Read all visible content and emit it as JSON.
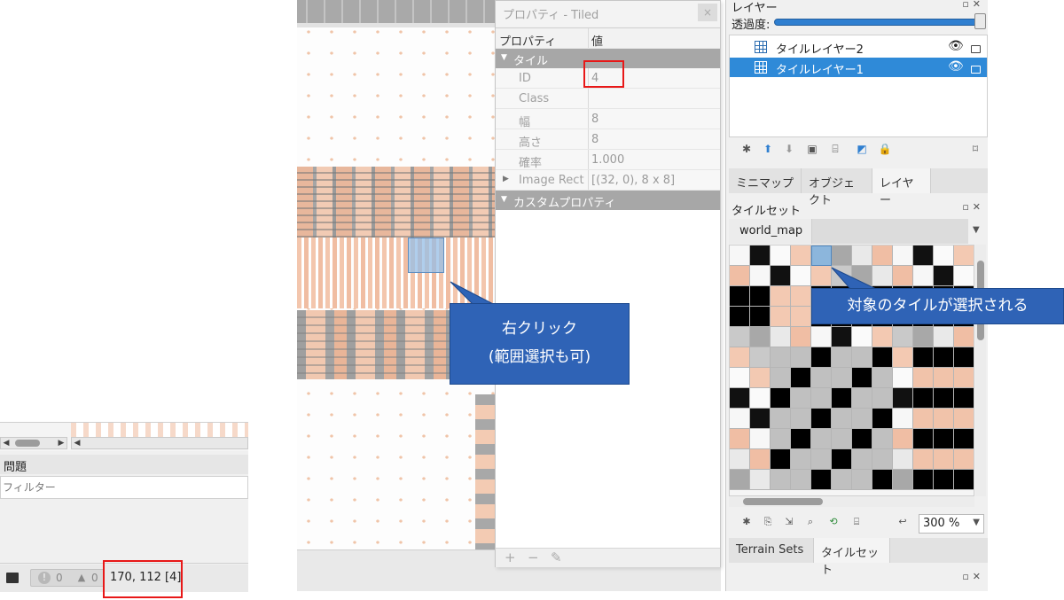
{
  "left_panel": {
    "issues_title": "問題",
    "filter_placeholder": "フィルター",
    "error_count": "0",
    "warning_count": "0",
    "coordinates": "170, 112 [4]"
  },
  "properties": {
    "window_title": "プロパティ - Tiled",
    "close_glyph": "×",
    "header_property": "プロパティ",
    "header_value": "値",
    "group_tile": "タイル",
    "rows": [
      {
        "key": "ID",
        "value": "4"
      },
      {
        "key": "Class",
        "value": ""
      },
      {
        "key": "幅",
        "value": "8"
      },
      {
        "key": "高さ",
        "value": "8"
      },
      {
        "key": "確率",
        "value": "1.000"
      },
      {
        "key": "Image Rect",
        "value": "[(32, 0), 8 x 8]"
      }
    ],
    "group_custom": "カスタムプロパティ",
    "toolbar": {
      "add": "+",
      "remove": "−",
      "edit": "✎"
    }
  },
  "layers_panel": {
    "title": "レイヤー",
    "opacity_label": "透過度:",
    "opacity_value": 1.0,
    "layers": [
      {
        "name": "タイルレイヤー2",
        "selected": false
      },
      {
        "name": "タイルレイヤー1",
        "selected": true
      }
    ],
    "tabs": [
      "ミニマップ",
      "オブジェクト",
      "レイヤー"
    ],
    "active_tab": "レイヤー"
  },
  "tileset_panel": {
    "title": "タイルセット",
    "tileset_name": "world_map",
    "zoom": "300 %",
    "bottom_tabs": [
      "Terrain Sets",
      "タイルセット"
    ],
    "active_bottom_tab": "タイルセット"
  },
  "annotations": {
    "callout_map_line1": "右クリック",
    "callout_map_line2": "(範囲選択も可)",
    "callout_tileset": "対象のタイルが選択される"
  },
  "colors": {
    "accent": "#2f8ad8",
    "callout": "#2f63b6",
    "highlight_box": "#e81818",
    "tile_selection": "#8cb6dc"
  }
}
